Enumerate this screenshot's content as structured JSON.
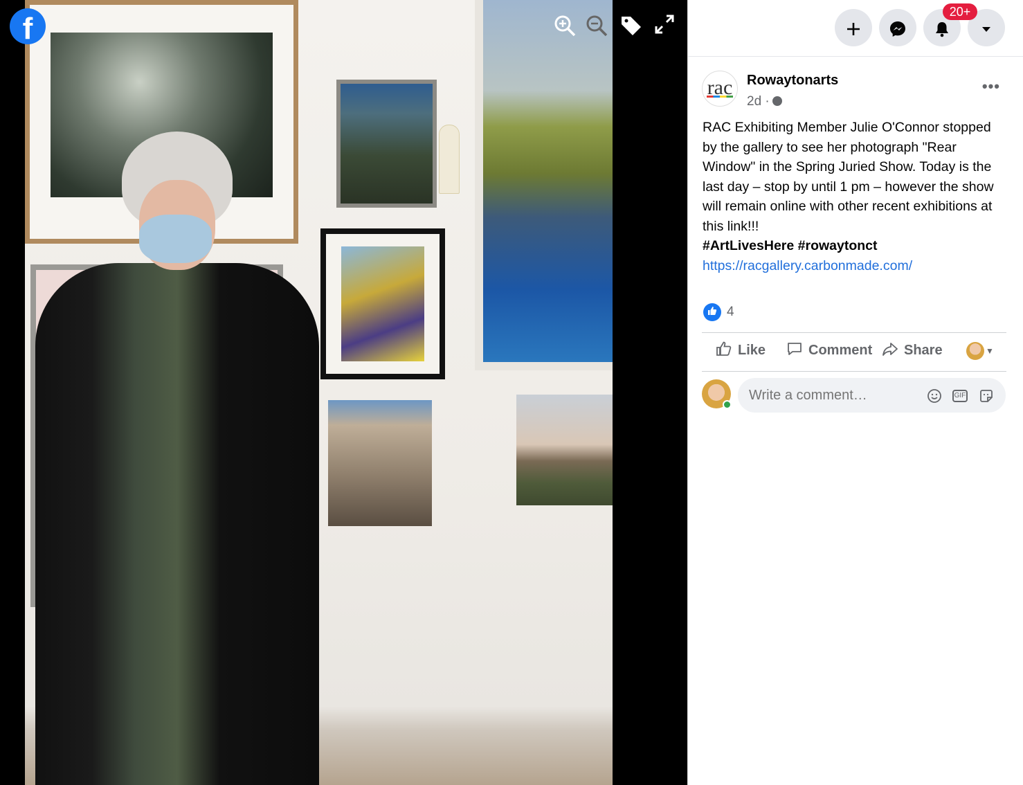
{
  "viewer": {
    "brand_icon": "facebook-logo",
    "tools": [
      "zoom-in-icon",
      "zoom-out-icon",
      "tag-icon",
      "fullscreen-icon"
    ]
  },
  "topnav": {
    "notifications_badge": "20+",
    "buttons": [
      "create-icon",
      "messenger-icon",
      "notifications-icon",
      "account-menu-icon"
    ]
  },
  "post": {
    "page_name": "Rowaytonarts",
    "avatar_text": "rac",
    "time": "2d ·",
    "text": "RAC Exhibiting Member Julie O'Connor stopped by the gallery to see her photograph \"Rear Window\" in the Spring Juried Show. Today is the last day – stop by until 1 pm – however the show will remain online with other recent exhibitions at this link!!!",
    "hashtags": "#ArtLivesHere #rowaytonct",
    "link": "https://racgallery.carbonmade.com/",
    "reaction_count": "4"
  },
  "actions": {
    "like": "Like",
    "comment": "Comment",
    "share": "Share"
  },
  "comment_box": {
    "placeholder": "Write a comment…"
  },
  "colors": {
    "facebook_blue": "#1877f2",
    "badge_red": "#e41e3f",
    "link_blue": "#216fdb",
    "online_green": "#31a24c"
  }
}
